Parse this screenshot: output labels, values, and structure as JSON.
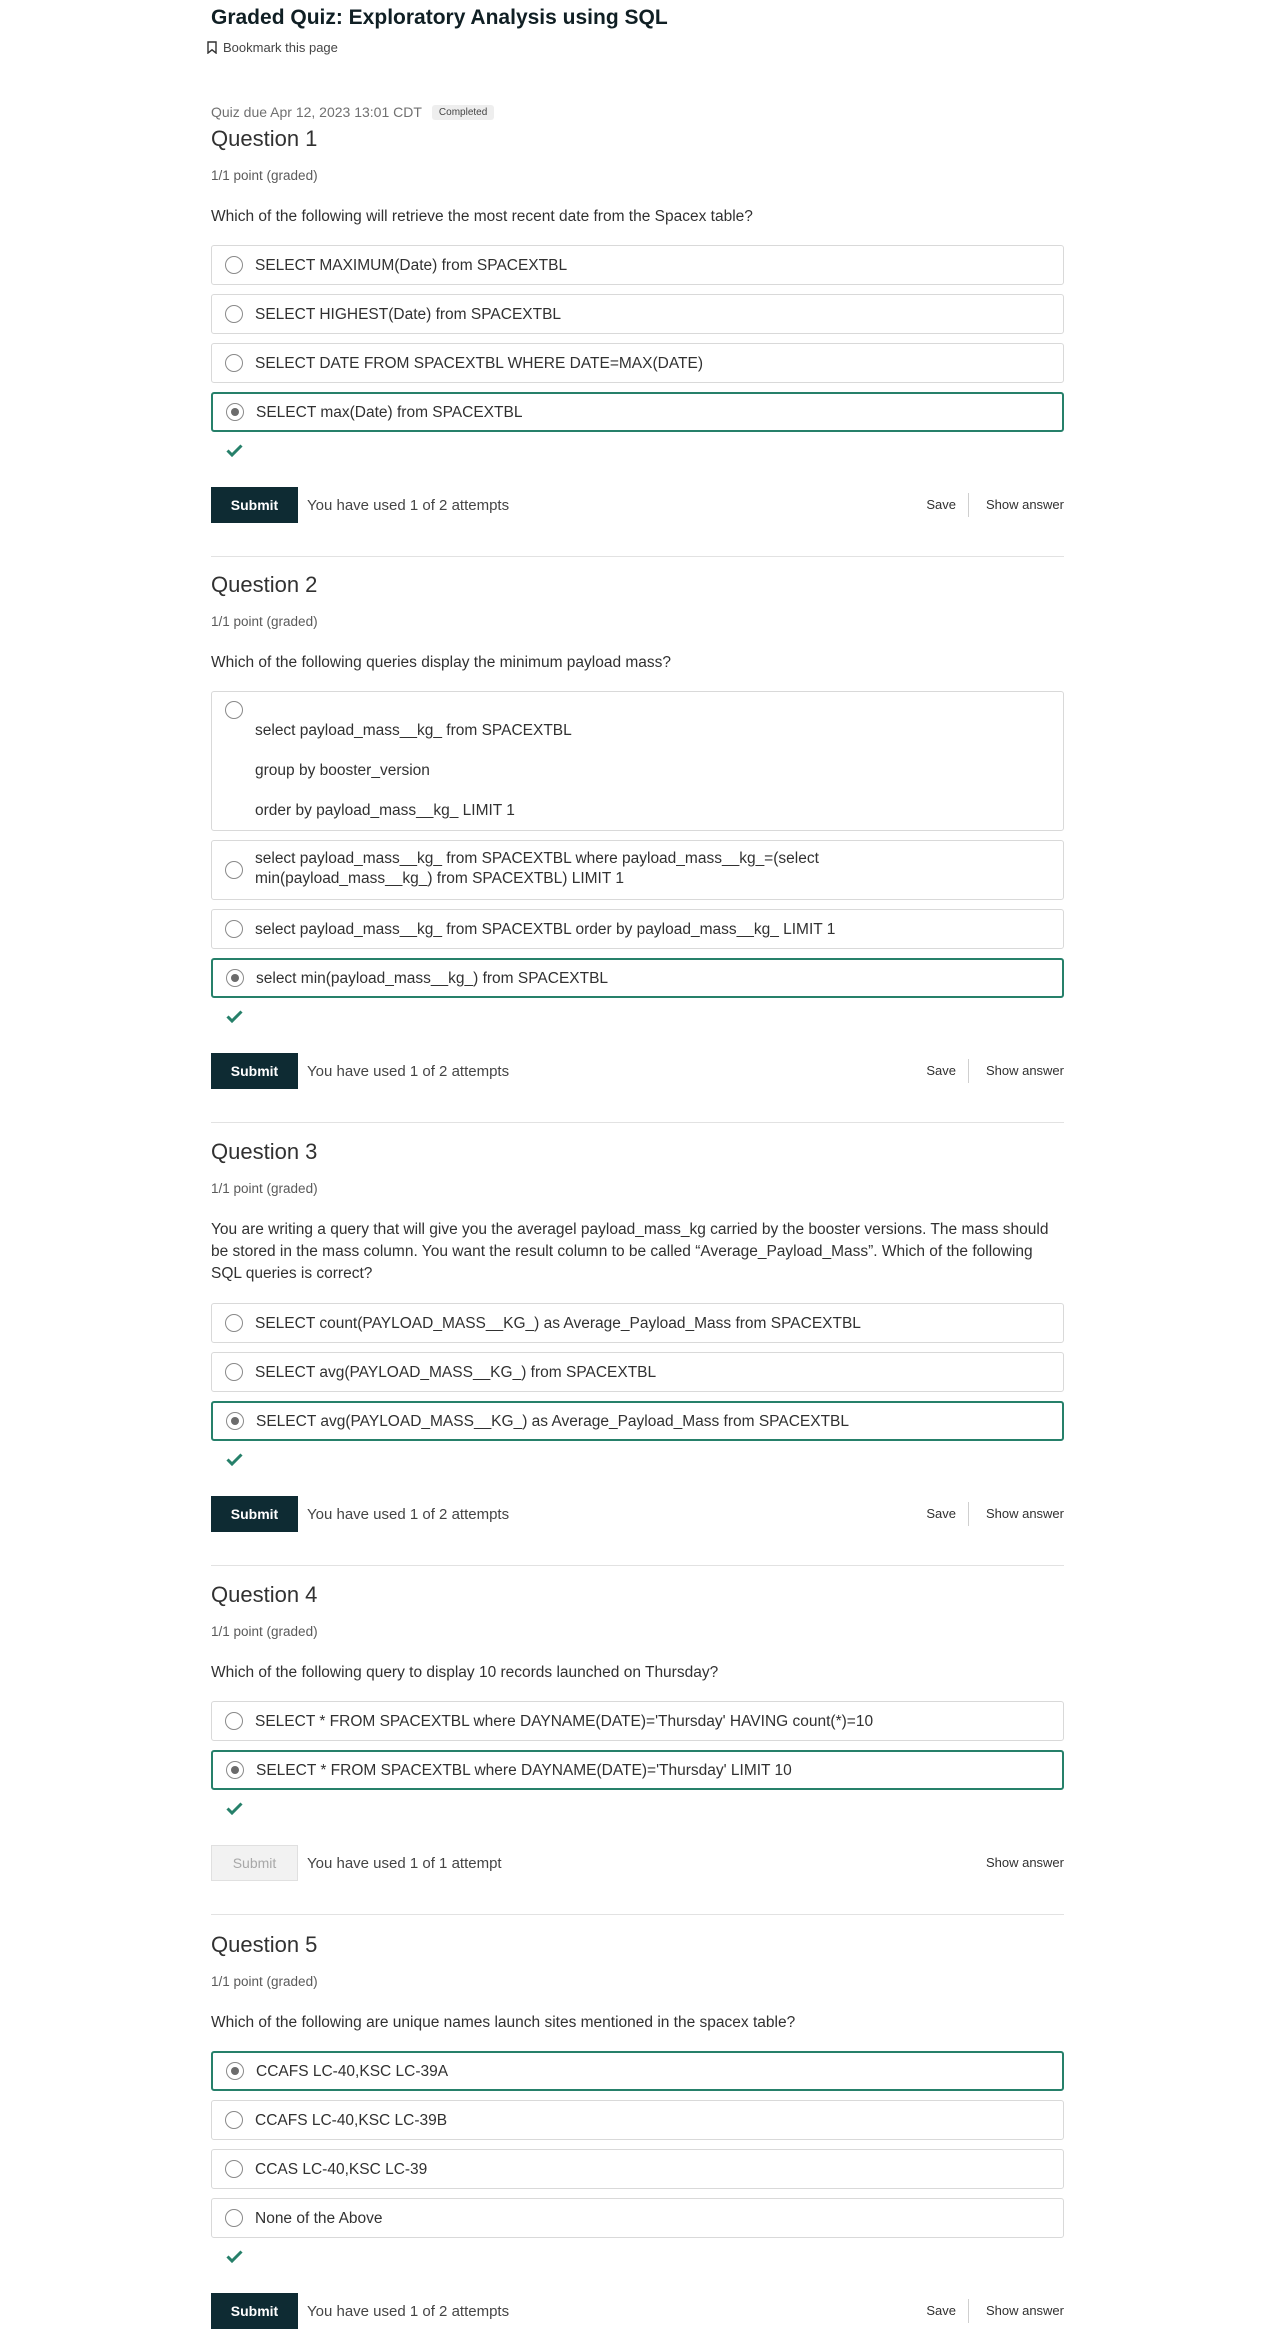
{
  "header": {
    "title": "Graded Quiz: Exploratory Analysis using SQL",
    "bookmark_label": "Bookmark this page",
    "due": "Quiz due Apr 12, 2023 13:01 CDT",
    "status_badge": "Completed"
  },
  "questions": [
    {
      "title": "Question 1",
      "points": "1/1 point (graded)",
      "prompt": "Which of the following will retrieve the most recent date from the Spacex table?",
      "options": [
        {
          "lines": [
            "SELECT MAXIMUM(Date) from SPACEXTBL"
          ],
          "selected": false
        },
        {
          "lines": [
            "SELECT HIGHEST(Date) from SPACEXTBL"
          ],
          "selected": false
        },
        {
          "lines": [
            "SELECT DATE FROM SPACEXTBL WHERE DATE=MAX(DATE)"
          ],
          "selected": false
        },
        {
          "lines": [
            "SELECT max(Date) from SPACEXTBL"
          ],
          "selected": true
        }
      ],
      "submit_label": "Submit",
      "submit_enabled": true,
      "attempts": "You have used 1 of 2 attempts",
      "save_label": "Save",
      "show_answer_label": "Show answer"
    },
    {
      "title": "Question 2",
      "points": "1/1 point (graded)",
      "prompt": "Which of the following queries display the minimum payload mass?",
      "options": [
        {
          "lines": [
            "select payload_mass__kg_ from SPACEXTBL",
            "group by booster_version",
            "order by payload_mass__kg_ LIMIT 1"
          ],
          "selected": false
        },
        {
          "lines": [
            "select payload_mass__kg_ from SPACEXTBL where payload_mass__kg_=(select",
            "min(payload_mass__kg_) from SPACEXTBL) LIMIT 1"
          ],
          "selected": false
        },
        {
          "lines": [
            "select payload_mass__kg_ from SPACEXTBL order by payload_mass__kg_ LIMIT 1"
          ],
          "selected": false
        },
        {
          "lines": [
            "select min(payload_mass__kg_) from SPACEXTBL"
          ],
          "selected": true
        }
      ],
      "submit_label": "Submit",
      "submit_enabled": true,
      "attempts": "You have used 1 of 2 attempts",
      "save_label": "Save",
      "show_answer_label": "Show answer"
    },
    {
      "title": "Question 3",
      "points": "1/1 point (graded)",
      "prompt": "You are writing a query that will give you the averagel payload_mass_kg carried by the booster versions. The mass should be stored in the mass column. You want the result column to be called “Average_Payload_Mass”. Which of the following SQL queries is correct?",
      "options": [
        {
          "lines": [
            "SELECT count(PAYLOAD_MASS__KG_) as Average_Payload_Mass from SPACEXTBL"
          ],
          "selected": false
        },
        {
          "lines": [
            "SELECT avg(PAYLOAD_MASS__KG_) from SPACEXTBL"
          ],
          "selected": false
        },
        {
          "lines": [
            "SELECT avg(PAYLOAD_MASS__KG_) as Average_Payload_Mass from SPACEXTBL"
          ],
          "selected": true
        }
      ],
      "submit_label": "Submit",
      "submit_enabled": true,
      "attempts": "You have used 1 of 2 attempts",
      "save_label": "Save",
      "show_answer_label": "Show answer"
    },
    {
      "title": "Question 4",
      "points": "1/1 point (graded)",
      "prompt": "Which of the following query to display 10 records launched on Thursday?",
      "options": [
        {
          "lines": [
            "SELECT * FROM SPACEXTBL where DAYNAME(DATE)='Thursday' HAVING count(*)=10"
          ],
          "selected": false
        },
        {
          "lines": [
            "SELECT * FROM SPACEXTBL where DAYNAME(DATE)='Thursday' LIMIT 10"
          ],
          "selected": true
        }
      ],
      "submit_label": "Submit",
      "submit_enabled": false,
      "attempts": "You have used 1 of 1 attempt",
      "save_label": "",
      "show_answer_label": "Show answer"
    },
    {
      "title": "Question 5",
      "points": "1/1 point (graded)",
      "prompt": "Which of the following are unique names launch sites mentioned in the spacex table?",
      "options": [
        {
          "lines": [
            "CCAFS LC-40,KSC LC-39A"
          ],
          "selected": true
        },
        {
          "lines": [
            "CCAFS LC-40,KSC LC-39B"
          ],
          "selected": false
        },
        {
          "lines": [
            "CCAS LC-40,KSC LC-39"
          ],
          "selected": false
        },
        {
          "lines": [
            "None of the Above"
          ],
          "selected": false
        }
      ],
      "submit_label": "Submit",
      "submit_enabled": true,
      "attempts": "You have used 1 of 2 attempts",
      "save_label": "Save",
      "show_answer_label": "Show answer"
    }
  ],
  "icons": {
    "bookmark": "bookmark-icon",
    "correct": "checkmark-icon",
    "radio": "radio-icon"
  },
  "colors": {
    "accent": "#26806a",
    "submit": "#0e2b33",
    "border": "#d9d9d9"
  }
}
